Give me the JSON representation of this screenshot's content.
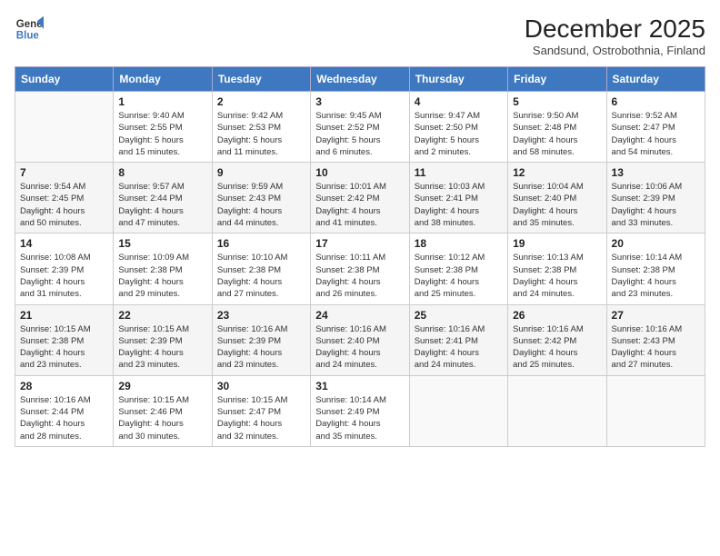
{
  "logo": {
    "line1": "General",
    "line2": "Blue"
  },
  "title": "December 2025",
  "subtitle": "Sandsund, Ostrobothnia, Finland",
  "days_of_week": [
    "Sunday",
    "Monday",
    "Tuesday",
    "Wednesday",
    "Thursday",
    "Friday",
    "Saturday"
  ],
  "weeks": [
    [
      {
        "num": "",
        "info": ""
      },
      {
        "num": "1",
        "info": "Sunrise: 9:40 AM\nSunset: 2:55 PM\nDaylight: 5 hours\nand 15 minutes."
      },
      {
        "num": "2",
        "info": "Sunrise: 9:42 AM\nSunset: 2:53 PM\nDaylight: 5 hours\nand 11 minutes."
      },
      {
        "num": "3",
        "info": "Sunrise: 9:45 AM\nSunset: 2:52 PM\nDaylight: 5 hours\nand 6 minutes."
      },
      {
        "num": "4",
        "info": "Sunrise: 9:47 AM\nSunset: 2:50 PM\nDaylight: 5 hours\nand 2 minutes."
      },
      {
        "num": "5",
        "info": "Sunrise: 9:50 AM\nSunset: 2:48 PM\nDaylight: 4 hours\nand 58 minutes."
      },
      {
        "num": "6",
        "info": "Sunrise: 9:52 AM\nSunset: 2:47 PM\nDaylight: 4 hours\nand 54 minutes."
      }
    ],
    [
      {
        "num": "7",
        "info": "Sunrise: 9:54 AM\nSunset: 2:45 PM\nDaylight: 4 hours\nand 50 minutes."
      },
      {
        "num": "8",
        "info": "Sunrise: 9:57 AM\nSunset: 2:44 PM\nDaylight: 4 hours\nand 47 minutes."
      },
      {
        "num": "9",
        "info": "Sunrise: 9:59 AM\nSunset: 2:43 PM\nDaylight: 4 hours\nand 44 minutes."
      },
      {
        "num": "10",
        "info": "Sunrise: 10:01 AM\nSunset: 2:42 PM\nDaylight: 4 hours\nand 41 minutes."
      },
      {
        "num": "11",
        "info": "Sunrise: 10:03 AM\nSunset: 2:41 PM\nDaylight: 4 hours\nand 38 minutes."
      },
      {
        "num": "12",
        "info": "Sunrise: 10:04 AM\nSunset: 2:40 PM\nDaylight: 4 hours\nand 35 minutes."
      },
      {
        "num": "13",
        "info": "Sunrise: 10:06 AM\nSunset: 2:39 PM\nDaylight: 4 hours\nand 33 minutes."
      }
    ],
    [
      {
        "num": "14",
        "info": "Sunrise: 10:08 AM\nSunset: 2:39 PM\nDaylight: 4 hours\nand 31 minutes."
      },
      {
        "num": "15",
        "info": "Sunrise: 10:09 AM\nSunset: 2:38 PM\nDaylight: 4 hours\nand 29 minutes."
      },
      {
        "num": "16",
        "info": "Sunrise: 10:10 AM\nSunset: 2:38 PM\nDaylight: 4 hours\nand 27 minutes."
      },
      {
        "num": "17",
        "info": "Sunrise: 10:11 AM\nSunset: 2:38 PM\nDaylight: 4 hours\nand 26 minutes."
      },
      {
        "num": "18",
        "info": "Sunrise: 10:12 AM\nSunset: 2:38 PM\nDaylight: 4 hours\nand 25 minutes."
      },
      {
        "num": "19",
        "info": "Sunrise: 10:13 AM\nSunset: 2:38 PM\nDaylight: 4 hours\nand 24 minutes."
      },
      {
        "num": "20",
        "info": "Sunrise: 10:14 AM\nSunset: 2:38 PM\nDaylight: 4 hours\nand 23 minutes."
      }
    ],
    [
      {
        "num": "21",
        "info": "Sunrise: 10:15 AM\nSunset: 2:38 PM\nDaylight: 4 hours\nand 23 minutes."
      },
      {
        "num": "22",
        "info": "Sunrise: 10:15 AM\nSunset: 2:39 PM\nDaylight: 4 hours\nand 23 minutes."
      },
      {
        "num": "23",
        "info": "Sunrise: 10:16 AM\nSunset: 2:39 PM\nDaylight: 4 hours\nand 23 minutes."
      },
      {
        "num": "24",
        "info": "Sunrise: 10:16 AM\nSunset: 2:40 PM\nDaylight: 4 hours\nand 24 minutes."
      },
      {
        "num": "25",
        "info": "Sunrise: 10:16 AM\nSunset: 2:41 PM\nDaylight: 4 hours\nand 24 minutes."
      },
      {
        "num": "26",
        "info": "Sunrise: 10:16 AM\nSunset: 2:42 PM\nDaylight: 4 hours\nand 25 minutes."
      },
      {
        "num": "27",
        "info": "Sunrise: 10:16 AM\nSunset: 2:43 PM\nDaylight: 4 hours\nand 27 minutes."
      }
    ],
    [
      {
        "num": "28",
        "info": "Sunrise: 10:16 AM\nSunset: 2:44 PM\nDaylight: 4 hours\nand 28 minutes."
      },
      {
        "num": "29",
        "info": "Sunrise: 10:15 AM\nSunset: 2:46 PM\nDaylight: 4 hours\nand 30 minutes."
      },
      {
        "num": "30",
        "info": "Sunrise: 10:15 AM\nSunset: 2:47 PM\nDaylight: 4 hours\nand 32 minutes."
      },
      {
        "num": "31",
        "info": "Sunrise: 10:14 AM\nSunset: 2:49 PM\nDaylight: 4 hours\nand 35 minutes."
      },
      {
        "num": "",
        "info": ""
      },
      {
        "num": "",
        "info": ""
      },
      {
        "num": "",
        "info": ""
      }
    ]
  ]
}
